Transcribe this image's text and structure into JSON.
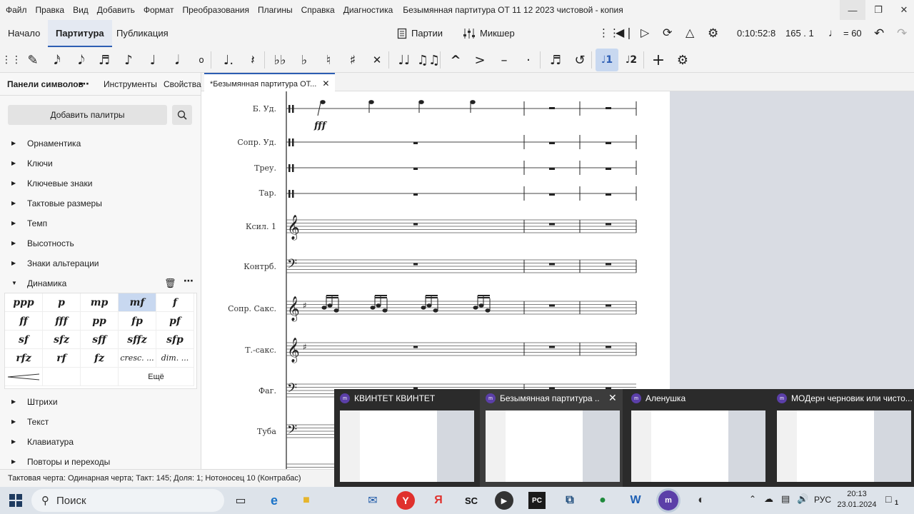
{
  "menu": [
    "Файл",
    "Правка",
    "Вид",
    "Добавить",
    "Формат",
    "Преобразования",
    "Плагины",
    "Справка",
    "Диагностика"
  ],
  "window_title": "Безымянная партитура ОТ 11 12 2023 чистовой - копия",
  "main_tabs": [
    "Начало",
    "Партитура",
    "Публикация"
  ],
  "active_main_tab": "Партитура",
  "parts_label": "Партии",
  "mixer_label": "Микшер",
  "playback_time": "0:10:52:8",
  "position": "165 . 1",
  "tempo": "= 60",
  "panel_tabs": [
    "Панели символов",
    "Инструменты",
    "Свойства"
  ],
  "add_palettes_label": "Добавить палитры",
  "categories_top": [
    "Орнаментика",
    "Ключи",
    "Ключевые знаки",
    "Тактовые размеры",
    "Темп",
    "Высотность",
    "Знаки альтерации"
  ],
  "dynamics_label": "Динамика",
  "dynamics_cells": [
    "ppp",
    "p",
    "mp",
    "mf",
    "f",
    "ff",
    "fff",
    "pp",
    "fp",
    "pf",
    "sf",
    "sfz",
    "sff",
    "sffz",
    "sfp",
    "rfz",
    "rf",
    "fz",
    "cresc. ...",
    "dim. ..."
  ],
  "dynamics_selected": "mf",
  "more_label": "Ещё",
  "categories_bottom": [
    "Штрихи",
    "Текст",
    "Клавиатура",
    "Повторы и переходы"
  ],
  "doc_tab": "*Безымянная партитура ОТ...",
  "instruments": [
    "Б. Уд.",
    "Сопр. Уд.",
    "Треу.",
    "Тар.",
    "Ксил. 1",
    "Контрб.",
    "Сопр. Сакс.",
    "Т.-сакс.",
    "Фаг.",
    "Туба"
  ],
  "dynamic_marking": "fff",
  "status": "Тактовая черта: Одинарная черта; Такт: 145; Доля: 1; Нотоносец 10 (Контрабас)",
  "taskbar_search": "Поиск",
  "tray_lang": "РУС",
  "clock_time": "20:13",
  "clock_date": "23.01.2024",
  "notification_count": "1",
  "thumbnails": [
    "КВИНТЕТ КВИНТЕТ",
    "Безымянная партитура ...",
    "Аленушка",
    "МОДерн черновик или чисто..."
  ],
  "colors": {
    "accent": "#2c5db3",
    "selected": "#c8d8f0",
    "taskbar": "#dde3ea"
  }
}
